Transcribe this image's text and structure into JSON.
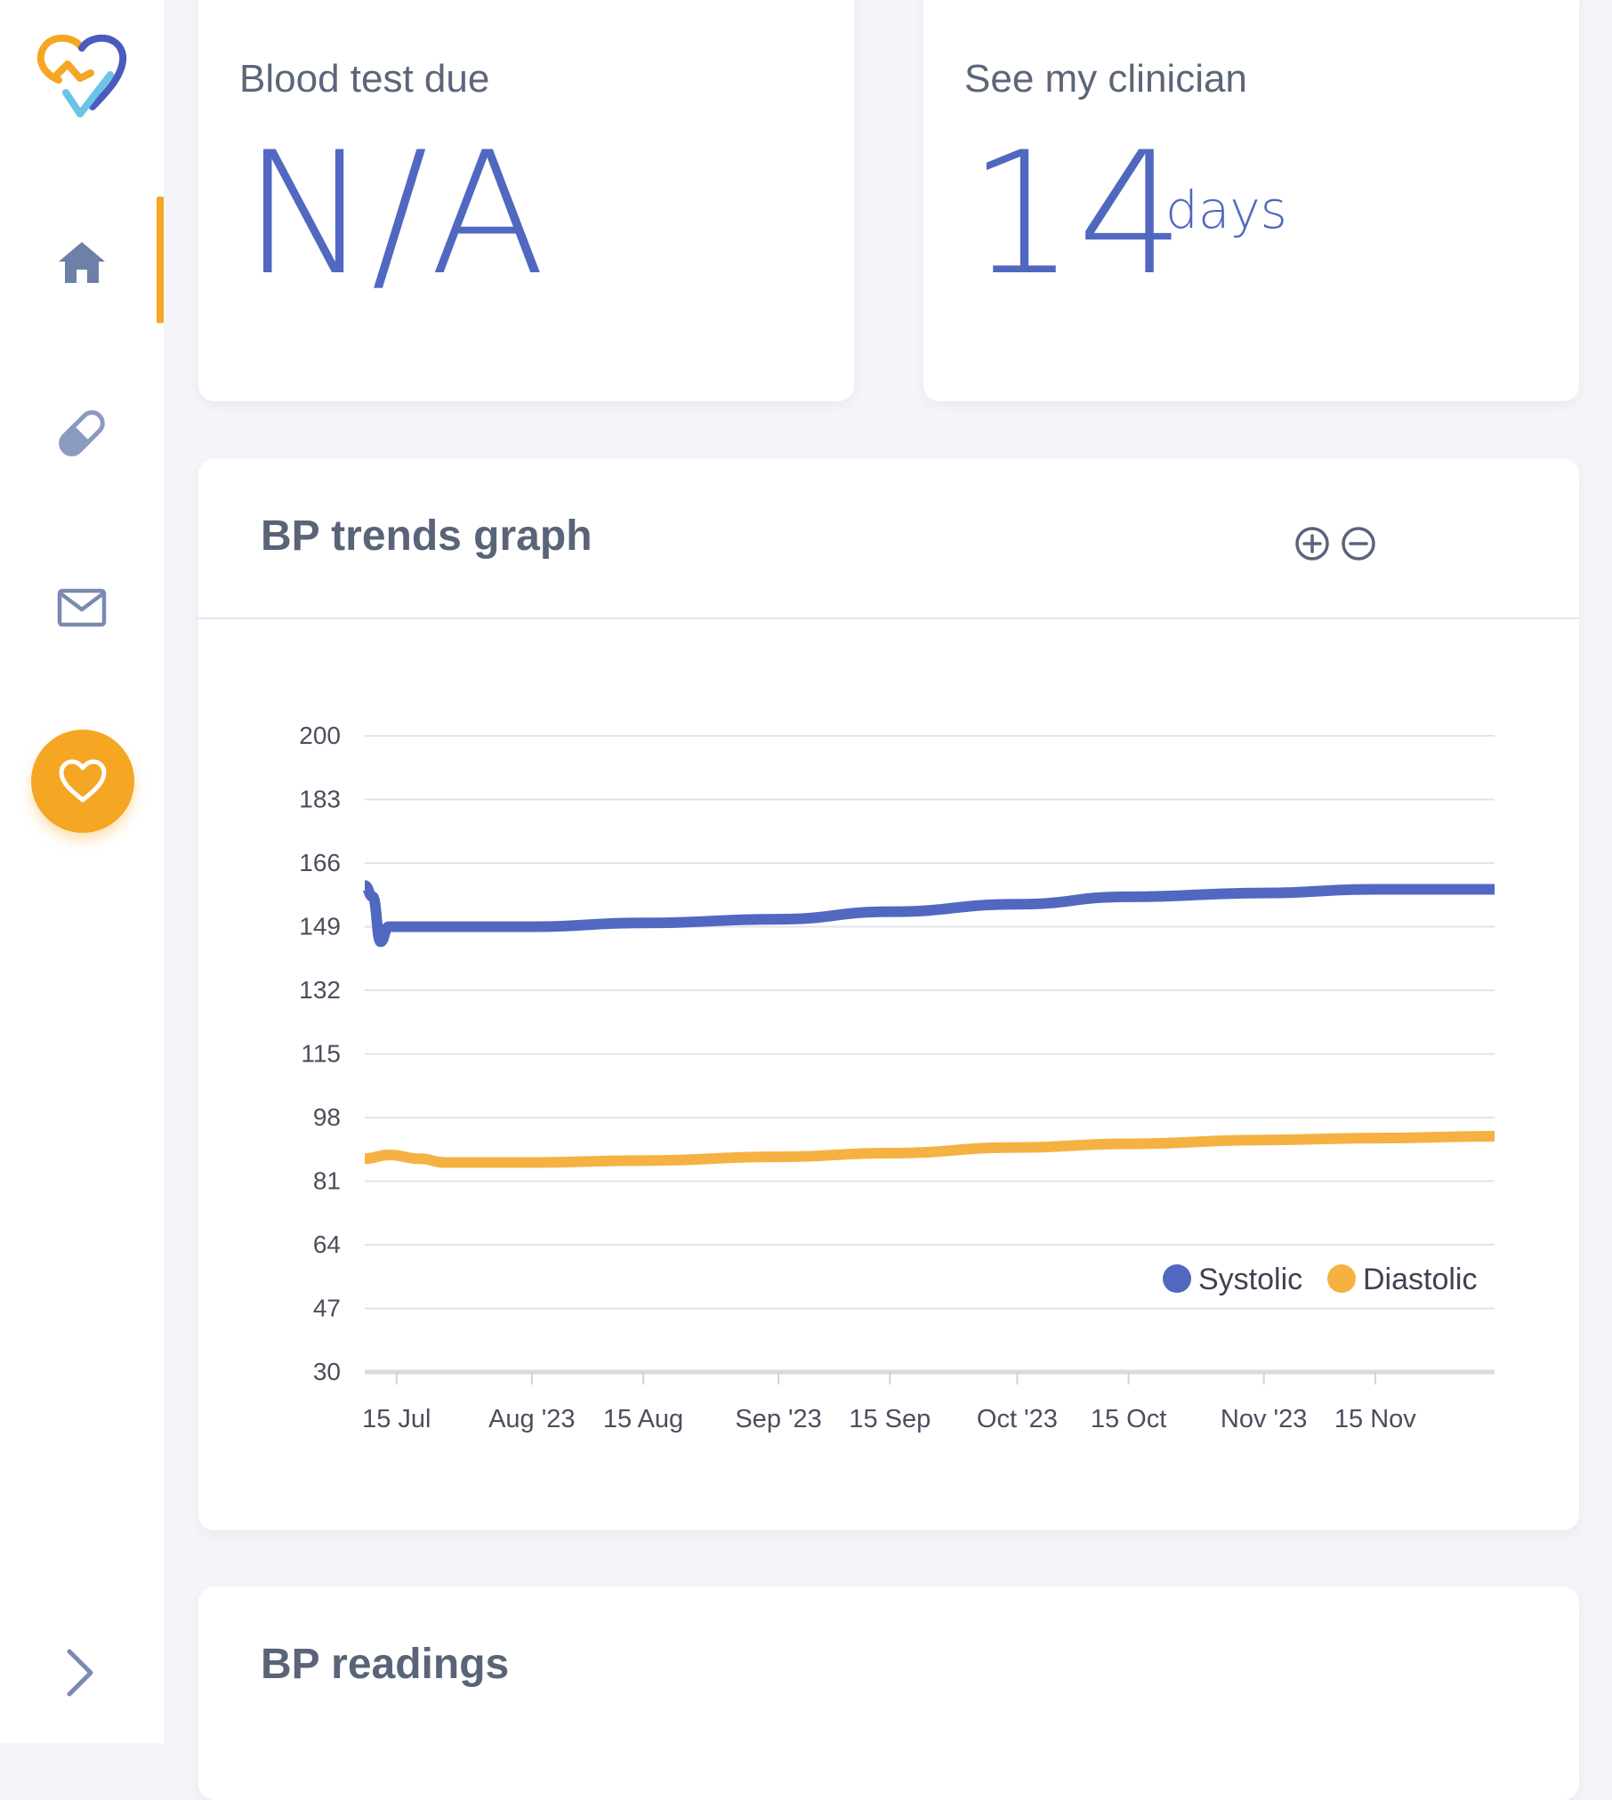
{
  "nav": {
    "items": [
      {
        "icon": "home-icon",
        "label": ""
      },
      {
        "icon": "pill-icon",
        "label": ""
      },
      {
        "icon": "mail-icon",
        "label": ""
      },
      {
        "icon": "heart-icon",
        "label": ""
      }
    ],
    "active_index": 0
  },
  "cards": {
    "blood_test": {
      "title": "Blood test due",
      "value": "N/A"
    },
    "clinician": {
      "title": "See my clinician",
      "value": "14",
      "unit": "days"
    }
  },
  "graph": {
    "title": "BP trends graph",
    "zoom_in_icon": "zoom-in-icon",
    "zoom_out_icon": "zoom-out-icon"
  },
  "readings": {
    "title": "BP readings"
  },
  "colors": {
    "systolic": "#5068c0",
    "diastolic": "#f5b142",
    "accent": "#f5a623"
  },
  "chart_data": {
    "type": "line",
    "title": "BP trends graph",
    "xlabel": "",
    "ylabel": "",
    "ylim": [
      30,
      200
    ],
    "y_ticks": [
      "200",
      "183",
      "166",
      "149",
      "132",
      "115",
      "98",
      "81",
      "64",
      "47",
      "30"
    ],
    "x_ticks": [
      {
        "label": "15 Jul",
        "date": "2023-07-15"
      },
      {
        "label": "Aug '23",
        "date": "2023-08-01"
      },
      {
        "label": "15 Aug",
        "date": "2023-08-15"
      },
      {
        "label": "Sep '23",
        "date": "2023-09-01"
      },
      {
        "label": "15 Sep",
        "date": "2023-09-15"
      },
      {
        "label": "Oct '23",
        "date": "2023-10-01"
      },
      {
        "label": "15 Oct",
        "date": "2023-10-15"
      },
      {
        "label": "Nov '23",
        "date": "2023-11-01"
      },
      {
        "label": "15 Nov",
        "date": "2023-11-15"
      }
    ],
    "xlim": [
      "2023-07-11",
      "2023-11-30"
    ],
    "legend": "bottom-right",
    "grid": true,
    "series": [
      {
        "name": "Systolic",
        "color": "#5068c0",
        "points": [
          [
            "2023-07-11",
            160
          ],
          [
            "2023-07-12",
            157
          ],
          [
            "2023-07-13",
            145
          ],
          [
            "2023-07-14",
            149
          ],
          [
            "2023-07-16",
            149
          ],
          [
            "2023-08-01",
            149
          ],
          [
            "2023-08-15",
            150
          ],
          [
            "2023-09-01",
            151
          ],
          [
            "2023-09-15",
            153
          ],
          [
            "2023-10-01",
            155
          ],
          [
            "2023-10-15",
            157
          ],
          [
            "2023-11-01",
            158
          ],
          [
            "2023-11-15",
            159
          ],
          [
            "2023-11-30",
            159
          ]
        ]
      },
      {
        "name": "Diastolic",
        "color": "#f5b142",
        "points": [
          [
            "2023-07-11",
            87
          ],
          [
            "2023-07-14",
            88
          ],
          [
            "2023-07-18",
            87
          ],
          [
            "2023-07-21",
            86
          ],
          [
            "2023-08-01",
            86
          ],
          [
            "2023-08-15",
            86.5
          ],
          [
            "2023-09-01",
            87.5
          ],
          [
            "2023-09-15",
            88.5
          ],
          [
            "2023-10-01",
            90
          ],
          [
            "2023-10-15",
            91
          ],
          [
            "2023-11-01",
            92
          ],
          [
            "2023-11-15",
            92.5
          ],
          [
            "2023-11-30",
            93
          ]
        ]
      }
    ]
  }
}
